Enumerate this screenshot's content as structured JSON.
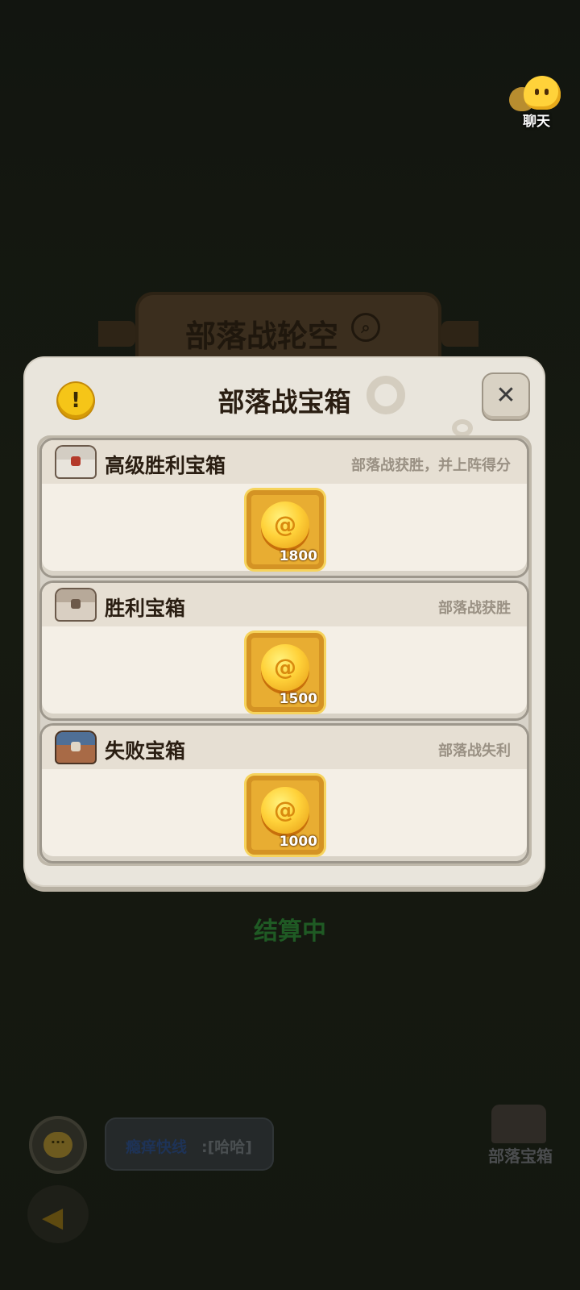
{
  "chat": {
    "label": "聊天"
  },
  "background": {
    "banner_title": "部落战轮空",
    "status": "结算中",
    "chat_preview": {
      "name": "瘾痒快线",
      "message": ":[哈哈]"
    },
    "tribe_chest_label": "部落宝箱"
  },
  "modal": {
    "title": "部落战宝箱",
    "info_symbol": "!",
    "close_symbol": "✕",
    "chests": [
      {
        "name": "高级胜利宝箱",
        "condition": "部落战获胜，并上阵得分",
        "reward": "1800",
        "color_body": "#e8e4dc",
        "color_lid": "#d3cdc3",
        "color_lock": "#b43a2a"
      },
      {
        "name": "胜利宝箱",
        "condition": "部落战获胜",
        "reward": "1500",
        "color_body": "#d9cfc2",
        "color_lid": "#b7a999",
        "color_lock": "#6d5a4a"
      },
      {
        "name": "失败宝箱",
        "condition": "部落战失利",
        "reward": "1000",
        "color_body": "#a86a46",
        "color_lid": "#4f6f96",
        "color_lock": "#e0d6c6"
      }
    ]
  }
}
